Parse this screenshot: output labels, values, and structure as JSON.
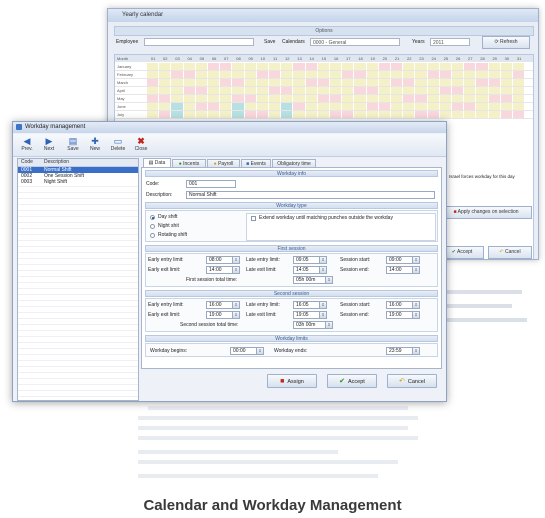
{
  "calendar": {
    "title": "Yearly calendar",
    "options_header": "Options",
    "employee_label": "Employee",
    "save_label": "Save",
    "calendar_label": "Calendars",
    "calendar_value": "0000 - General",
    "year_label": "Years",
    "year_value": "2011",
    "refresh_label": "Refresh",
    "month_col": "Month",
    "days": [
      "01",
      "02",
      "03",
      "04",
      "05",
      "06",
      "07",
      "08",
      "09",
      "10",
      "11",
      "12",
      "13",
      "14",
      "15",
      "16",
      "17",
      "18",
      "19",
      "20",
      "21",
      "22",
      "23",
      "24",
      "25",
      "26",
      "27",
      "28",
      "29",
      "30",
      "31"
    ],
    "months": [
      "January",
      "February",
      "March",
      "April",
      "May",
      "June",
      "July"
    ],
    "cell_code": "S.T.",
    "right_panel": {
      "checkbox_label": "Israel forces workday for this day",
      "apply_label": "Apply changes on selection",
      "accept_label": "Accept",
      "cancel_label": "Cancel"
    }
  },
  "workday": {
    "title": "Workday management",
    "toolbar": [
      {
        "label": "Prev.",
        "icon": "arrow-left-icon"
      },
      {
        "label": "Next",
        "icon": "arrow-right-icon"
      },
      {
        "label": "Save",
        "icon": "save-icon"
      },
      {
        "label": "New",
        "icon": "new-icon"
      },
      {
        "label": "Delete",
        "icon": "delete-icon"
      },
      {
        "label": "Close",
        "icon": "close-icon"
      }
    ],
    "list": {
      "col_code": "Code",
      "col_desc": "Description",
      "rows": [
        {
          "code": "0001",
          "desc": "Normal Shift",
          "selected": true
        },
        {
          "code": "0002",
          "desc": "One Session Shift",
          "selected": false
        },
        {
          "code": "0003",
          "desc": "Night Shift",
          "selected": false
        }
      ]
    },
    "tabs": [
      "Data",
      "Incents",
      "Payroll",
      "Events",
      "Obligatory time"
    ],
    "info": {
      "header": "Workday info",
      "code_label": "Code:",
      "code_value": "001",
      "desc_label": "Description:",
      "desc_value": "Normal Shift"
    },
    "type": {
      "header": "Workday type",
      "options": [
        "Day shift",
        "Night shit",
        "Rotating shift"
      ],
      "checkbox_label": "Extend workday until matching punches outside the workday"
    },
    "first": {
      "header": "First session",
      "early_entry_label": "Early entry limit:",
      "early_entry": "08:00",
      "late_entry_label": "Late entry limit:",
      "late_entry": "09:05",
      "session_start_label": "Session start:",
      "session_start": "09:00",
      "early_exit_label": "Early exit limit:",
      "early_exit": "14:00",
      "late_exit_label": "Late exit limit:",
      "late_exit": "14:05",
      "session_end_label": "Session end:",
      "session_end": "14:00",
      "total_label": "First session total time:",
      "total": "05h 00m"
    },
    "second": {
      "header": "Second session",
      "early_entry_label": "Early entry limit:",
      "early_entry": "16:00",
      "late_entry_label": "Late entry limit:",
      "late_entry": "16:05",
      "session_start_label": "Session start:",
      "session_start": "16:00",
      "early_exit_label": "Early exit limit:",
      "early_exit": "19:00",
      "late_exit_label": "Late exit limit:",
      "late_exit": "19:05",
      "session_end_label": "Session end:",
      "session_end": "19:00",
      "total_label": "Second session total time:",
      "total": "03h 00m"
    },
    "limits": {
      "header": "Workday limits",
      "begins_label": "Workday begins:",
      "begins": "00:00",
      "ends_label": "Workday ends:",
      "ends": "23:59"
    },
    "buttons": {
      "assign": "Assign",
      "accept": "Accept",
      "cancel": "Cancel"
    }
  },
  "colors": {
    "accent": "#3a6fc8",
    "weekend": "#f8d7dd",
    "workday": "#f4f1c9",
    "holiday": "#b8e0e2",
    "selection": "#3a6fc8"
  },
  "caption": "Calendar and Workday Management"
}
